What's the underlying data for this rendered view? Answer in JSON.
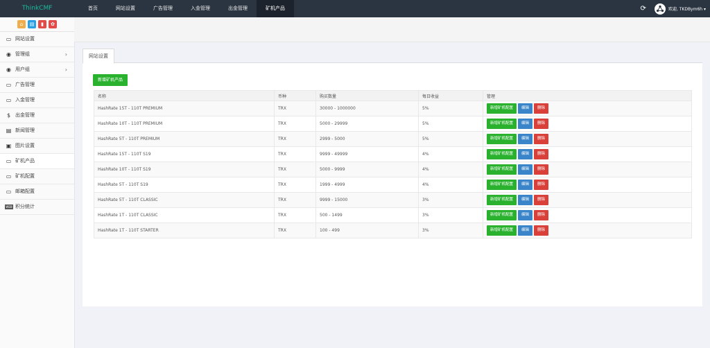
{
  "app": {
    "logo": "ThinkCMF"
  },
  "topnav": {
    "items": [
      "首页",
      "网站设置",
      "广告管理",
      "入金管理",
      "出金管理",
      "矿机产品"
    ],
    "active_index": 5,
    "user_label": "欢迎, TKDBym6h ▾"
  },
  "quick_buttons": {
    "colors": [
      "#f0ad4e",
      "#2d9fe0",
      "#e14c48",
      "#e14c48"
    ],
    "icons": [
      "home-icon",
      "file-icon",
      "trash-icon",
      "gear-icon"
    ]
  },
  "sidebar": {
    "items": [
      {
        "label": "网站设置",
        "icon": "monitor-icon",
        "chevron": false
      },
      {
        "label": "管理组",
        "icon": "user-circle-icon",
        "chevron": true
      },
      {
        "label": "用户组",
        "icon": "user-circle-icon",
        "chevron": true
      },
      {
        "label": "广告管理",
        "icon": "monitor-icon",
        "chevron": false
      },
      {
        "label": "入金管理",
        "icon": "monitor-icon",
        "chevron": false
      },
      {
        "label": "出金管理",
        "icon": "dollar-icon",
        "chevron": false
      },
      {
        "label": "新闻管理",
        "icon": "newspaper-icon",
        "chevron": false
      },
      {
        "label": "图片设置",
        "icon": "image-icon",
        "chevron": false
      },
      {
        "label": "矿机产品",
        "icon": "monitor-icon",
        "chevron": false
      },
      {
        "label": "矿机配置",
        "icon": "monitor-icon",
        "chevron": false
      },
      {
        "label": "邮箱配置",
        "icon": "monitor-icon",
        "chevron": false
      },
      {
        "label": "积分统计",
        "icon": "web-icon",
        "chevron": false
      }
    ],
    "active_index": 8,
    "web_icon_text": "WEB"
  },
  "main": {
    "tab_label": "网站设置",
    "add_button": "新增矿机产品",
    "columns": [
      "名称",
      "币种",
      "购买数量",
      "每日收益",
      "管理"
    ],
    "row_actions": {
      "config": "新增矿机配置",
      "edit": "编辑",
      "delete": "删除"
    },
    "rows": [
      [
        "HashRate 15T - 110T PREMIUM",
        "TRX",
        "30000 - 1000000",
        "5%"
      ],
      [
        "HashRate 10T - 110T PREMIUM",
        "TRX",
        "5000 - 29999",
        "5%"
      ],
      [
        "HashRate 5T - 110T PREMIUM",
        "TRX",
        "2999 - 5000",
        "5%"
      ],
      [
        "HashRate 15T - 110T S19",
        "TRX",
        "9999 - 49999",
        "4%"
      ],
      [
        "HashRate 10T - 110T S19",
        "TRX",
        "5000 - 9999",
        "4%"
      ],
      [
        "HashRate 5T - 110T S19",
        "TRX",
        "1999 - 4999",
        "4%"
      ],
      [
        "HashRate 5T - 110T CLASSIC",
        "TRX",
        "9999 - 15000",
        "3%"
      ],
      [
        "HashRate 1T - 110T CLASSIC",
        "TRX",
        "500 - 1499",
        "3%"
      ],
      [
        "HashRate 1T - 110T STARTER",
        "TRX",
        "100 - 499",
        "3%"
      ]
    ]
  }
}
